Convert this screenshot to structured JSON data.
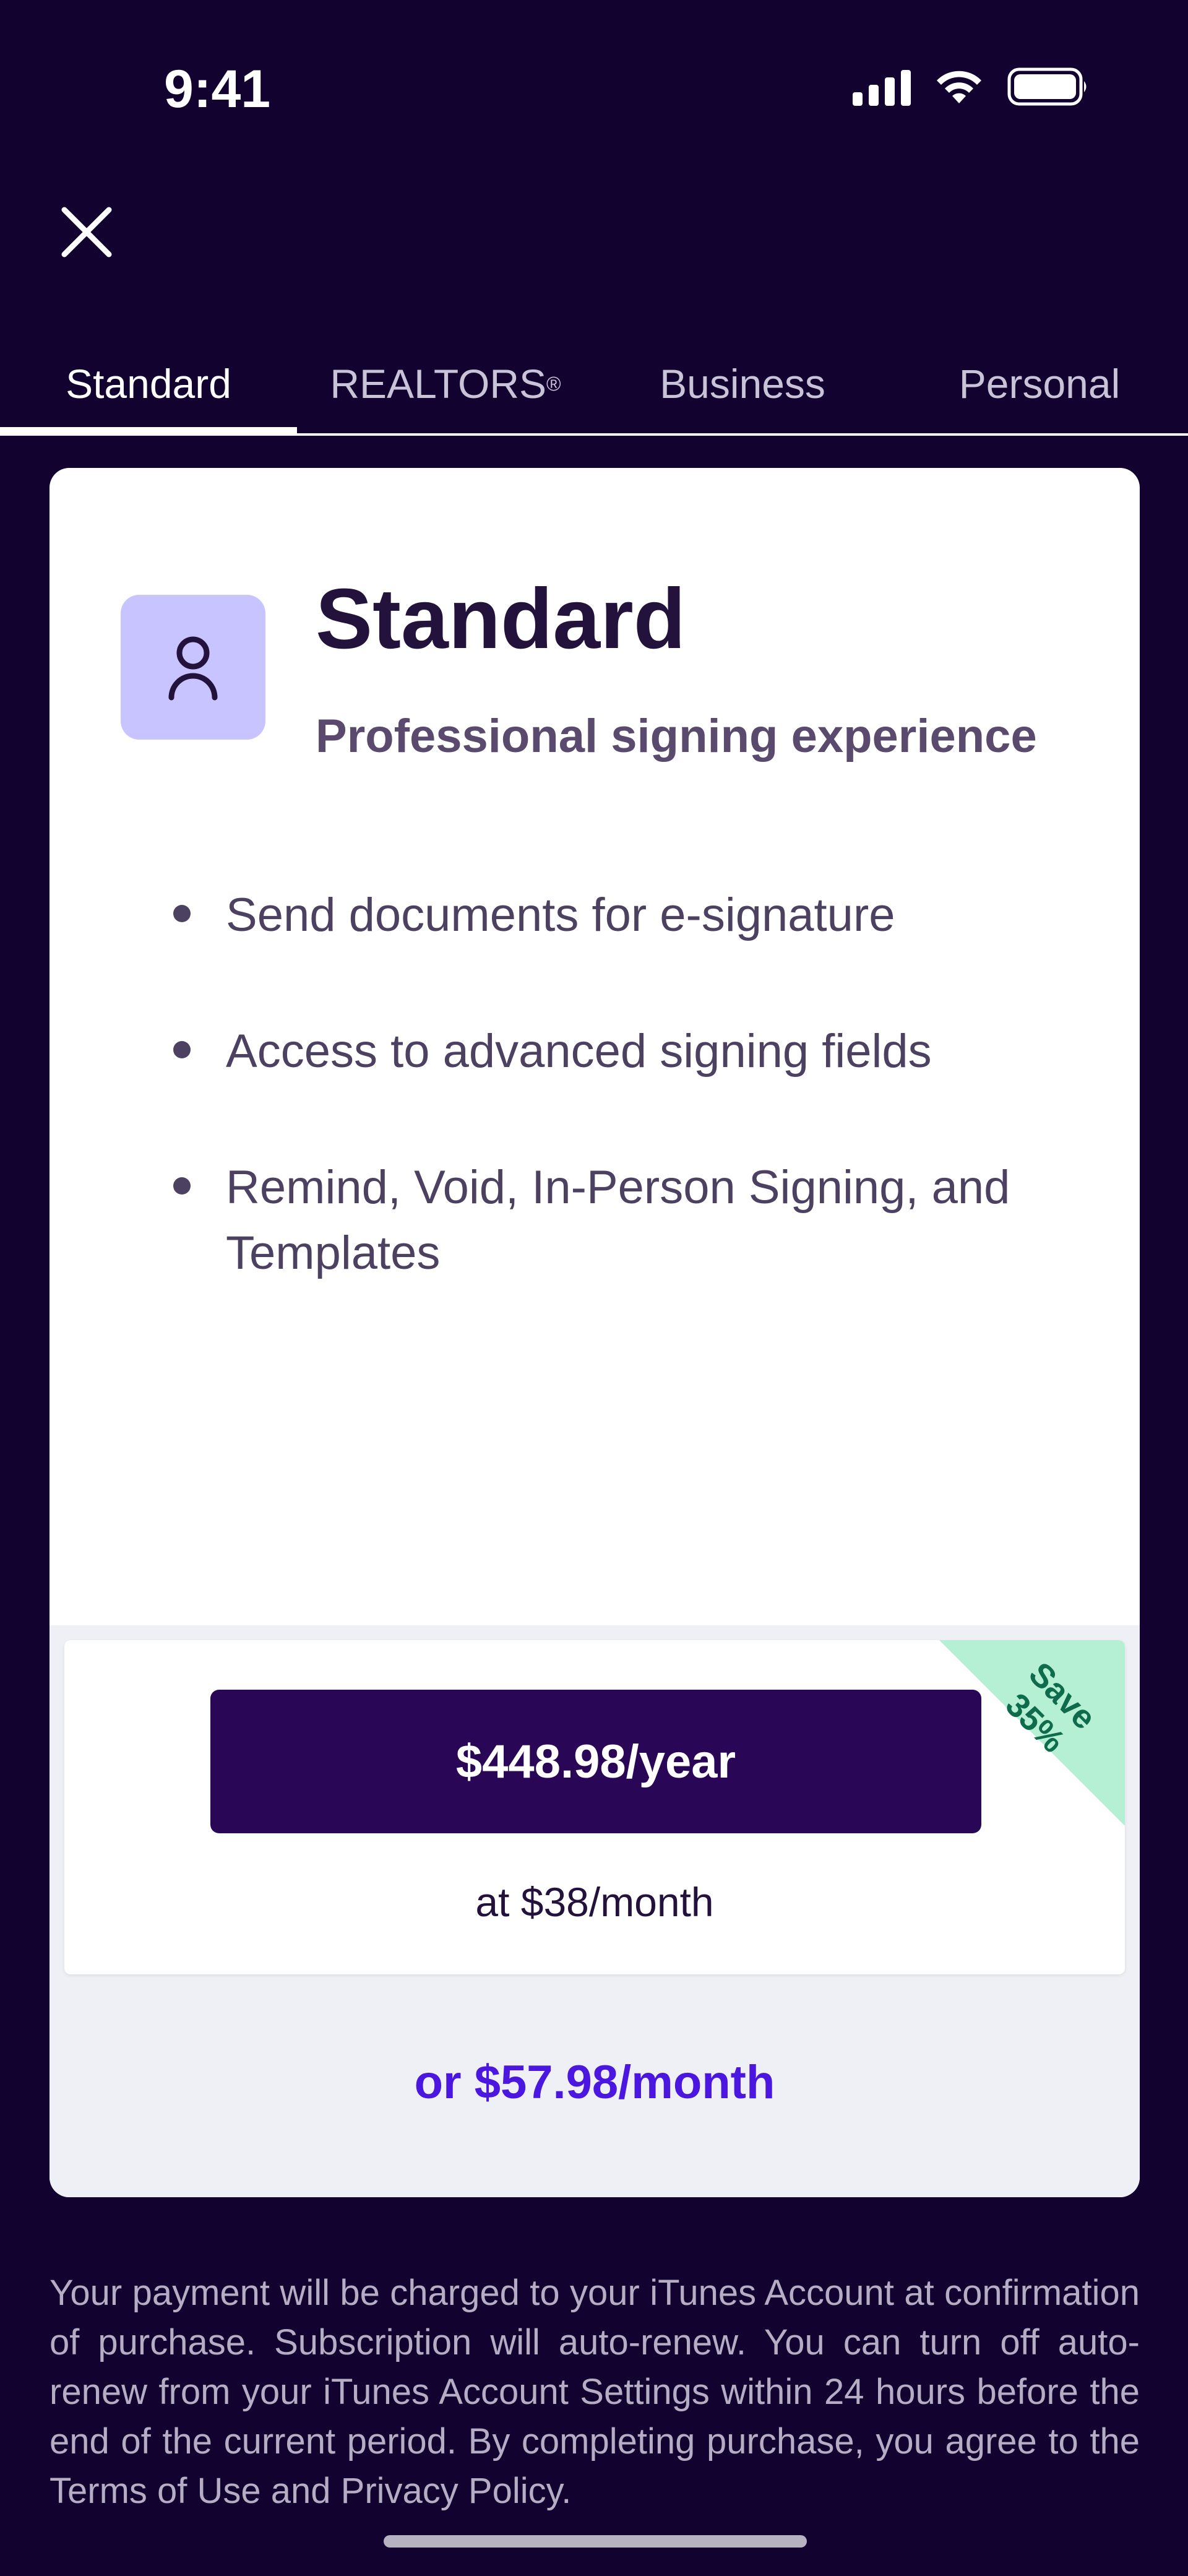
{
  "status_bar": {
    "time": "9:41",
    "icons": [
      "signal-icon",
      "wifi-icon",
      "battery-icon"
    ]
  },
  "header": {
    "close_icon": "close-icon"
  },
  "tabs": [
    {
      "label": "Standard",
      "active": true
    },
    {
      "label": "REALTORS",
      "sup": "®",
      "active": false
    },
    {
      "label": "Business",
      "active": false
    },
    {
      "label": "Personal",
      "active": false
    }
  ],
  "plan": {
    "icon": "user-icon",
    "title": "Standard",
    "subtitle": "Professional signing experience",
    "features": [
      "Send documents for e-signature",
      "Access to advanced signing fields",
      "Remind, Void, In-Person Signing, and Templates"
    ]
  },
  "pricing": {
    "annual_button": "$448.98/year",
    "annual_per_month": "at $38/month",
    "save_badge_line1": "Save",
    "save_badge_line2": "35%",
    "monthly_option": "or $57.98/month"
  },
  "legal_text": "Your payment will be charged to your iTunes Account at confirmation of purchase. Subscription will auto-renew. You can turn off auto-renew from your iTunes Account Settings within 24 hours before the end of the current period. By completing purchase, you agree to the Terms of Use and Privacy Policy.",
  "colors": {
    "background": "#12022f",
    "primary_button": "#2a0656",
    "accent_link": "#4a16e0",
    "plan_icon_bg": "#c7c4ff",
    "save_badge_bg": "#b6f0d4",
    "save_badge_text": "#0e6b4b"
  }
}
